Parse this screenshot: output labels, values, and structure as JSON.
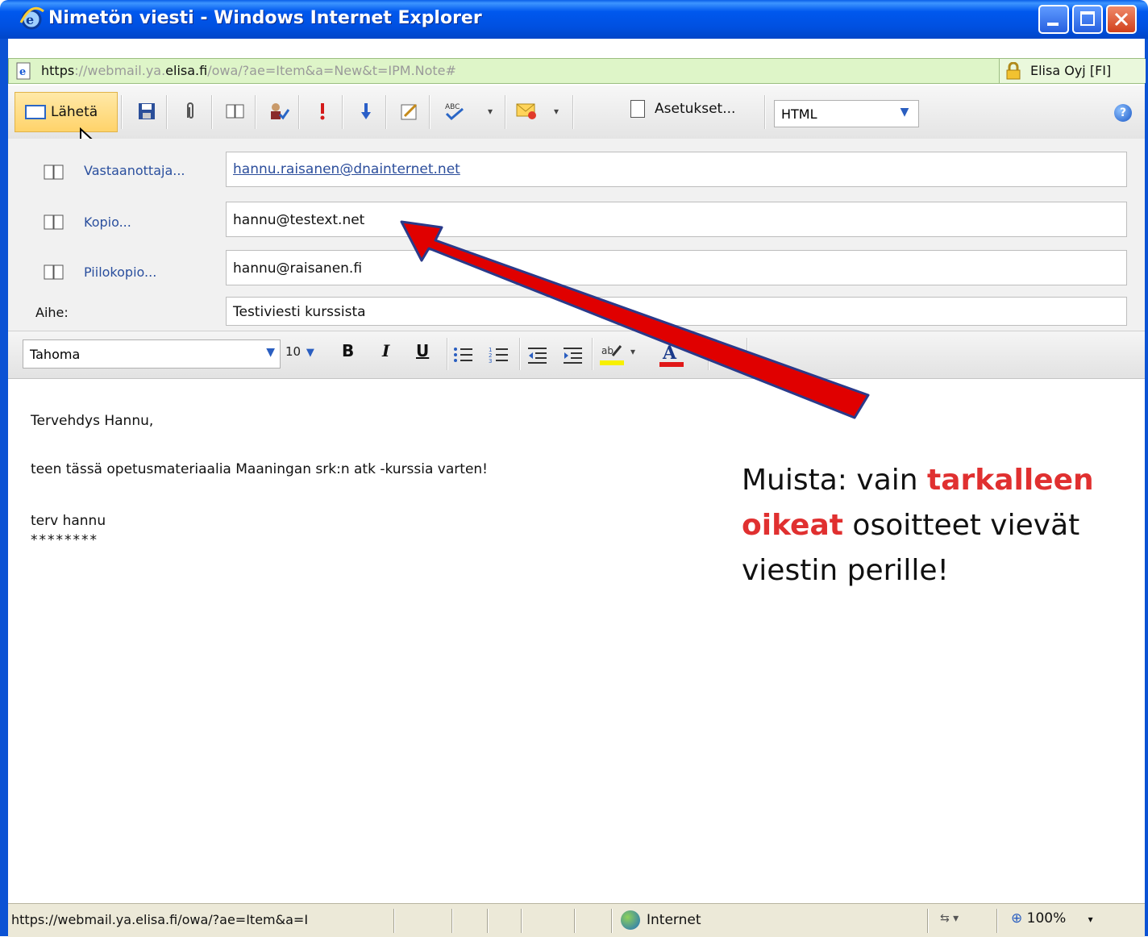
{
  "window": {
    "title": "Nimetön viesti - Windows Internet Explorer"
  },
  "address": {
    "url_https": "https",
    "url_part1": "://webmail.ya.",
    "url_dark": "elisa.fi",
    "url_rest": "/owa/?ae=Item&a=New&t=IPM.Note#",
    "certificate": "Elisa Oyj [FI]"
  },
  "toolbar": {
    "send_label": "Lähetä",
    "options_label": "Asetukset...",
    "format_value": "HTML"
  },
  "header": {
    "to_label": "Vastaanottaja...",
    "to_value": "hannu.raisanen@dnainternet.net",
    "cc_label": "Kopio...",
    "cc_value": "hannu@testext.net",
    "bcc_label": "Piilokopio...",
    "bcc_value": "hannu@raisanen.fi",
    "subject_label": "Aihe:",
    "subject_value": "Testiviesti kurssista"
  },
  "format_bar": {
    "font_value": "Tahoma",
    "size_value": "10",
    "bold": "B",
    "italic": "I",
    "underline": "U"
  },
  "message": {
    "line1": "Tervehdys Hannu,",
    "line2": "teen tässä opetusmateriaalia Maaningan srk:n atk -kurssia varten!",
    "line3": "terv hannu",
    "line4": "********"
  },
  "annotation": {
    "pre": "Muista: vain ",
    "highlight": "tarkalleen oikeat",
    "post": " osoitteet vievät viestin perille!",
    "highlight_color": "#e03030",
    "arrow_color": "#e00000"
  },
  "status": {
    "url": "https://webmail.ya.elisa.fi/owa/?ae=Item&a=I",
    "zone": "Internet",
    "zoom": "100%"
  },
  "icons": [
    "ie-logo-icon",
    "page-icon",
    "lock-icon",
    "envelope-icon",
    "save-icon",
    "attach-icon",
    "address-book-icon",
    "check-names-icon",
    "importance-high-icon",
    "importance-low-icon",
    "signature-icon",
    "spell-check-icon",
    "message-options-icon",
    "help-icon",
    "pointer-cursor-icon",
    "bullets-icon",
    "numbering-icon",
    "outdent-icon",
    "indent-icon",
    "highlight-icon",
    "font-color-icon",
    "globe-icon",
    "zoom-icon"
  ]
}
